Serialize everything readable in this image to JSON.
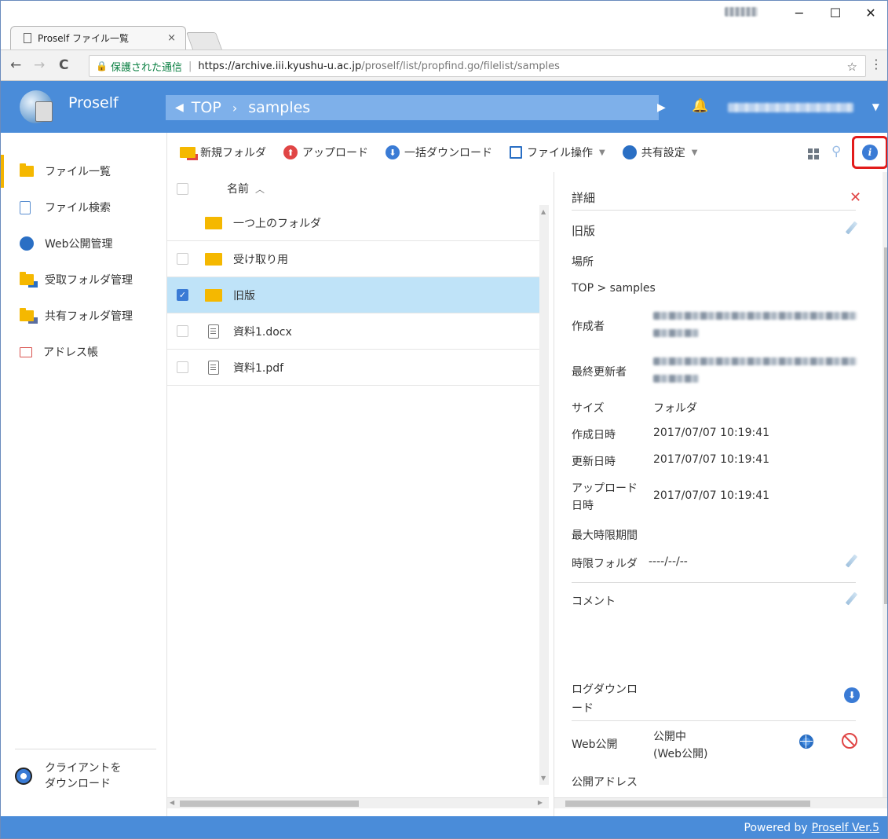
{
  "browser": {
    "tab_title": "Proself ファイル一覧",
    "tab_close": "×",
    "window_min": "−",
    "window_max": "☐",
    "window_close": "✕",
    "back": "←",
    "forward": "→",
    "reload": "C",
    "secure_label": "保護された通信",
    "url_host": "https://archive.iii.kyushu-u.ac.jp",
    "url_path": "/proself/list/propfind.go/filelist/samples",
    "bookmark": "☆",
    "menu": "⋮"
  },
  "header": {
    "app_name": "Proself",
    "breadcrumb": [
      "TOP",
      "samples"
    ],
    "crumb_separator": "›",
    "prev_arrow": "◀",
    "next_arrow": "▶",
    "bell": "🔔",
    "user_caret": "▼"
  },
  "sidebar": {
    "items": [
      {
        "label": "ファイル一覧",
        "icon": "folder-icon"
      },
      {
        "label": "ファイル検索",
        "icon": "file-search-icon"
      },
      {
        "label": "Web公開管理",
        "icon": "globe-icon"
      },
      {
        "label": "受取フォルダ管理",
        "icon": "receive-folder-icon"
      },
      {
        "label": "共有フォルダ管理",
        "icon": "shared-folder-icon"
      },
      {
        "label": "アドレス帳",
        "icon": "address-book-icon"
      }
    ],
    "client_download": [
      "クライアントを",
      "ダウンロード"
    ]
  },
  "toolbar": {
    "new_folder": "新規フォルダ",
    "upload": "アップロード",
    "bulk_download": "一括ダウンロード",
    "file_ops": "ファイル操作",
    "share_settings": "共有設定",
    "caret": "▼",
    "tooltip": "詳細",
    "info": "i"
  },
  "filelist": {
    "header_name": "名前",
    "sort_arrow": "︿",
    "rows": [
      {
        "name": "一つ上のフォルダ",
        "type": "folder",
        "checkbox": false,
        "selected": false
      },
      {
        "name": "受け取り用",
        "type": "folder",
        "checkbox": true,
        "selected": false
      },
      {
        "name": "旧版",
        "type": "folder",
        "checkbox": true,
        "selected": true
      },
      {
        "name": "資料1.docx",
        "type": "file",
        "checkbox": true,
        "selected": false
      },
      {
        "name": "資料1.pdf",
        "type": "file",
        "checkbox": true,
        "selected": false
      }
    ],
    "check_mark": "✓",
    "scroll_up": "▲",
    "scroll_down": "▼",
    "scroll_left": "◀",
    "scroll_right": "▶"
  },
  "detail": {
    "title": "詳細",
    "close": "✕",
    "name": "旧版",
    "location_label": "場所",
    "location_value": "TOP  >  samples",
    "creator_label": "作成者",
    "updater_label": "最終更新者",
    "size_label": "サイズ",
    "size_value": "フォルダ",
    "created_label": "作成日時",
    "created_value": "2017/07/07 10:19:41",
    "updated_label": "更新日時",
    "updated_value": "2017/07/07 10:19:41",
    "upload_label_1": "アップロード",
    "upload_label_2": "日時",
    "upload_value": "2017/07/07 10:19:41",
    "max_period_label": "最大時限期間",
    "time_folder_label": "時限フォルダ",
    "time_folder_value": "----/--/--",
    "comment_label": "コメント",
    "log_download_1": "ログダウンロ",
    "log_download_2": "ード",
    "web_publish_label": "Web公開",
    "web_publish_value_1": "公開中",
    "web_publish_value_2": "(Web公開)",
    "public_address_label": "公開アドレス",
    "download_arrow": "⬇"
  },
  "footer": {
    "powered": "Powered by",
    "link": "Proself Ver.5"
  }
}
